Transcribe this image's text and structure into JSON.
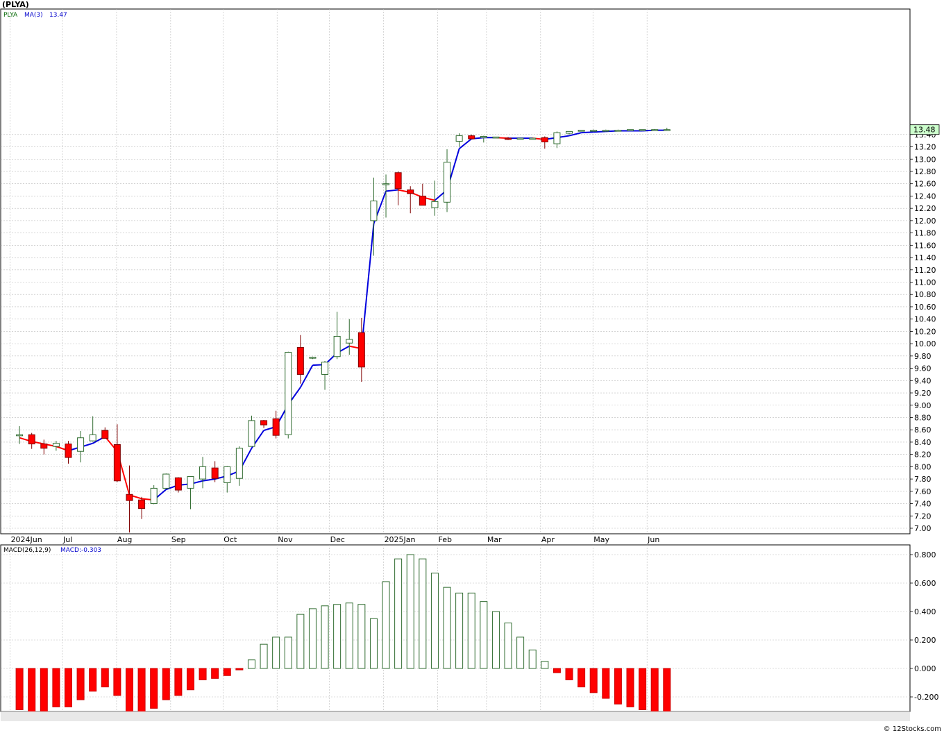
{
  "page": {
    "title": "(PLYA)",
    "footer": "© 12Stocks.com"
  },
  "price_panel": {
    "legend_symbol": "PLYA",
    "legend_ma_label": "MA(3)",
    "legend_ma_value": "13.47",
    "last_price_tag": "13.48",
    "colors": {
      "up": "#008000",
      "down": "#ff0000",
      "ma_up": "#0000dd",
      "ma_down": "#ff0000",
      "tag_bg": "#ccffcc"
    }
  },
  "macd_panel": {
    "legend_label": "MACD(26,12,9)",
    "legend_value": "MACD:-0.303",
    "colors": {
      "pos": "#008000",
      "neg": "#ff0000"
    }
  },
  "chart_data": [
    {
      "type": "candlestick",
      "title": "(PLYA)",
      "interval": "weekly",
      "ylim": [
        6.9,
        13.6
      ],
      "y_ticks": [
        "7.00",
        "7.20",
        "7.40",
        "7.60",
        "7.80",
        "8.00",
        "8.20",
        "8.40",
        "8.60",
        "8.80",
        "9.00",
        "9.20",
        "9.40",
        "9.60",
        "9.80",
        "10.00",
        "10.20",
        "10.40",
        "10.60",
        "10.80",
        "11.00",
        "11.20",
        "11.40",
        "11.60",
        "11.80",
        "12.00",
        "12.20",
        "12.40",
        "12.60",
        "12.80",
        "13.00",
        "13.20",
        "13.40"
      ],
      "x_labels": [
        "2024Jun",
        "Jul",
        "Aug",
        "Sep",
        "Oct",
        "Nov",
        "Dec",
        "2025Jan",
        "Feb",
        "Mar",
        "Apr",
        "May",
        "Jun"
      ],
      "weeks": [
        "2024-06-03",
        "2024-06-10",
        "2024-06-17",
        "2024-06-24",
        "2024-07-01",
        "2024-07-08",
        "2024-07-15",
        "2024-07-22",
        "2024-07-29",
        "2024-08-05",
        "2024-08-12",
        "2024-08-19",
        "2024-08-26",
        "2024-09-02",
        "2024-09-09",
        "2024-09-16",
        "2024-09-23",
        "2024-09-30",
        "2024-10-07",
        "2024-10-14",
        "2024-10-21",
        "2024-10-28",
        "2024-11-04",
        "2024-11-11",
        "2024-11-18",
        "2024-11-25",
        "2024-12-02",
        "2024-12-09",
        "2024-12-16",
        "2024-12-23",
        "2024-12-30",
        "2025-01-06",
        "2025-01-13",
        "2025-01-20",
        "2025-01-27",
        "2025-02-03",
        "2025-02-10",
        "2025-02-17",
        "2025-02-24",
        "2025-03-03",
        "2025-03-10",
        "2025-03-17",
        "2025-03-24",
        "2025-03-31",
        "2025-04-07",
        "2025-04-14",
        "2025-04-21",
        "2025-04-28",
        "2025-05-05",
        "2025-05-12",
        "2025-05-19",
        "2025-05-26",
        "2025-06-02",
        "2025-06-09"
      ],
      "series": [
        {
          "name": "PLYA",
          "ohlc": [
            [
              8.52,
              8.66,
              8.37,
              8.52
            ],
            [
              8.52,
              8.55,
              8.29,
              8.37
            ],
            [
              8.37,
              8.44,
              8.2,
              8.3
            ],
            [
              8.33,
              8.42,
              8.26,
              8.38
            ],
            [
              8.37,
              8.42,
              8.05,
              8.15
            ],
            [
              8.25,
              8.58,
              8.07,
              8.47
            ],
            [
              8.42,
              8.82,
              8.41,
              8.52
            ],
            [
              8.59,
              8.64,
              8.46,
              8.46
            ],
            [
              8.36,
              8.69,
              7.75,
              7.77
            ],
            [
              7.55,
              8.02,
              6.93,
              7.45
            ],
            [
              7.46,
              7.51,
              7.15,
              7.32
            ],
            [
              7.4,
              7.7,
              7.39,
              7.65
            ],
            [
              7.65,
              7.89,
              7.63,
              7.88
            ],
            [
              7.82,
              7.83,
              7.58,
              7.62
            ],
            [
              7.65,
              7.84,
              7.31,
              7.84
            ],
            [
              7.8,
              8.16,
              7.65,
              8.0
            ],
            [
              7.98,
              8.09,
              7.75,
              7.81
            ],
            [
              7.74,
              8.01,
              7.58,
              8.0
            ],
            [
              7.81,
              8.33,
              7.69,
              8.3
            ],
            [
              8.33,
              8.83,
              8.38,
              8.75
            ],
            [
              8.75,
              8.76,
              8.63,
              8.68
            ],
            [
              8.78,
              8.91,
              8.46,
              8.51
            ],
            [
              8.52,
              9.87,
              8.46,
              9.86
            ],
            [
              9.94,
              10.14,
              9.35,
              9.5
            ],
            [
              9.78,
              9.79,
              9.75,
              9.78
            ],
            [
              9.5,
              9.72,
              9.25,
              9.7
            ],
            [
              9.79,
              10.52,
              9.75,
              10.12
            ],
            [
              10.01,
              10.4,
              9.82,
              10.07
            ],
            [
              10.18,
              10.42,
              9.38,
              9.62
            ],
            [
              12.0,
              12.7,
              11.43,
              12.32
            ],
            [
              12.6,
              12.75,
              12.05,
              12.6
            ],
            [
              12.78,
              12.8,
              12.25,
              12.52
            ],
            [
              12.5,
              12.56,
              12.12,
              12.44
            ],
            [
              12.4,
              12.6,
              12.26,
              12.25
            ],
            [
              12.21,
              12.65,
              12.08,
              12.31
            ],
            [
              12.3,
              13.16,
              12.14,
              12.95
            ],
            [
              13.29,
              13.42,
              13.2,
              13.38
            ],
            [
              13.38,
              13.4,
              13.32,
              13.33
            ],
            [
              13.35,
              13.38,
              13.27,
              13.37
            ],
            [
              13.35,
              13.36,
              13.35,
              13.36
            ],
            [
              13.34,
              13.36,
              13.31,
              13.32
            ],
            [
              13.33,
              13.35,
              13.33,
              13.34
            ],
            [
              13.33,
              13.35,
              13.32,
              13.34
            ],
            [
              13.35,
              13.37,
              13.17,
              13.28
            ],
            [
              13.25,
              13.45,
              13.18,
              13.43
            ],
            [
              13.42,
              13.45,
              13.4,
              13.45
            ],
            [
              13.46,
              13.47,
              13.45,
              13.47
            ],
            [
              13.47,
              13.48,
              13.46,
              13.47
            ],
            [
              13.47,
              13.48,
              13.46,
              13.47
            ],
            [
              13.47,
              13.48,
              13.46,
              13.47
            ],
            [
              13.47,
              13.48,
              13.47,
              13.48
            ],
            [
              13.47,
              13.48,
              13.47,
              13.48
            ],
            [
              13.48,
              13.49,
              13.47,
              13.48
            ],
            [
              13.48,
              13.51,
              13.47,
              13.48
            ]
          ]
        },
        {
          "name": "MA(3)",
          "values": [
            8.47,
            8.41,
            8.37,
            8.33,
            8.26,
            8.32,
            8.38,
            8.49,
            8.25,
            7.54,
            7.48,
            7.46,
            7.63,
            7.7,
            7.72,
            7.77,
            7.8,
            7.85,
            7.93,
            8.3,
            8.59,
            8.65,
            9.01,
            9.29,
            9.65,
            9.66,
            9.85,
            9.96,
            9.92,
            11.95,
            12.48,
            12.5,
            12.46,
            12.38,
            12.33,
            12.5,
            13.17,
            13.33,
            13.35,
            13.35,
            13.34,
            13.34,
            13.34,
            13.32,
            13.35,
            13.38,
            13.43,
            13.44,
            13.45,
            13.46,
            13.46,
            13.46,
            13.47,
            13.47
          ]
        }
      ]
    },
    {
      "type": "bar",
      "title": "MACD(26,12,9)",
      "ylim": [
        -0.32,
        0.84
      ],
      "y_ticks": [
        "-0.200",
        "0.000",
        "0.200",
        "0.400",
        "0.600",
        "0.800"
      ],
      "x_labels": [
        "2024Jun",
        "Jul",
        "Aug",
        "Sep",
        "Oct",
        "Nov",
        "Dec",
        "2025Jan",
        "Feb",
        "Mar",
        "Apr",
        "May",
        "Jun"
      ],
      "series": [
        {
          "name": "MACD",
          "values": [
            -0.29,
            -0.31,
            -0.3,
            -0.27,
            -0.27,
            -0.22,
            -0.16,
            -0.13,
            -0.19,
            -0.3,
            -0.32,
            -0.28,
            -0.22,
            -0.19,
            -0.15,
            -0.08,
            -0.07,
            -0.05,
            -0.01,
            0.06,
            0.17,
            0.22,
            0.22,
            0.38,
            0.42,
            0.44,
            0.45,
            0.46,
            0.45,
            0.35,
            0.61,
            0.77,
            0.8,
            0.77,
            0.67,
            0.57,
            0.53,
            0.53,
            0.47,
            0.4,
            0.32,
            0.22,
            0.13,
            0.05,
            -0.03,
            -0.08,
            -0.13,
            -0.17,
            -0.21,
            -0.25,
            -0.27,
            -0.29,
            -0.3,
            -0.3
          ]
        }
      ]
    }
  ]
}
